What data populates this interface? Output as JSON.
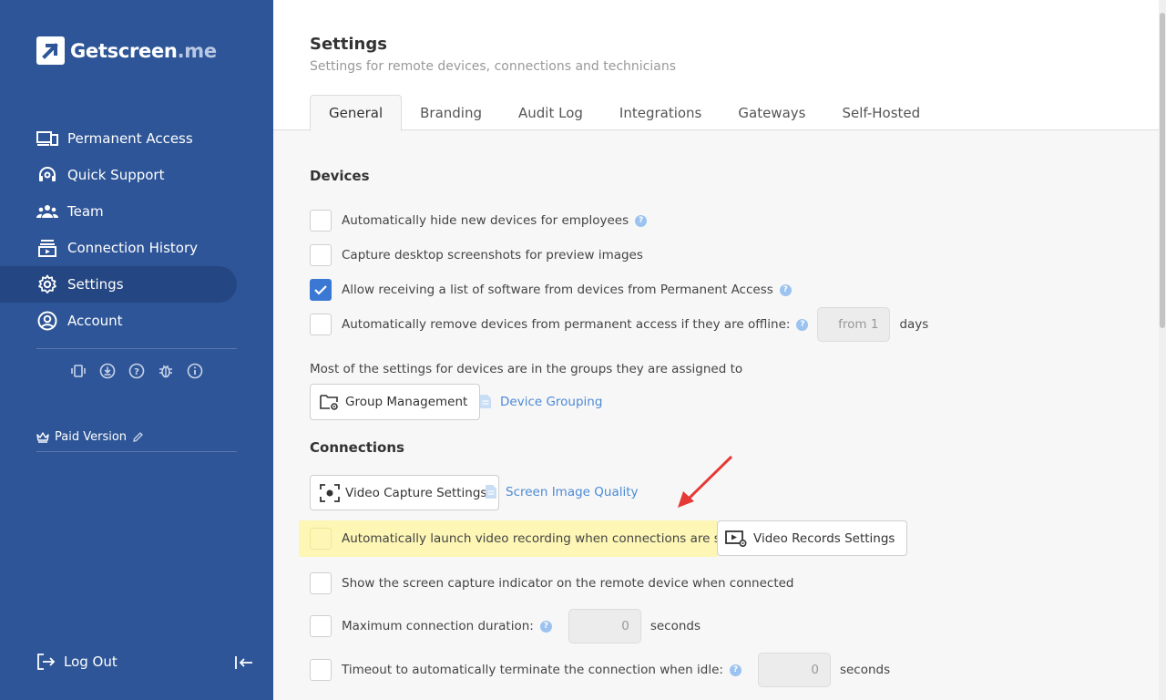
{
  "brand": {
    "name": "Getscreen",
    "suffix": ".me"
  },
  "nav": [
    {
      "label": "Permanent Access",
      "icon": "devices-icon"
    },
    {
      "label": "Quick Support",
      "icon": "headset-icon"
    },
    {
      "label": "Team",
      "icon": "team-icon"
    },
    {
      "label": "Connection History",
      "icon": "history-icon"
    },
    {
      "label": "Settings",
      "icon": "gear-icon",
      "active": true
    },
    {
      "label": "Account",
      "icon": "user-circle-icon"
    }
  ],
  "sidebar_footer": {
    "plan": "Paid Version",
    "logout": "Log Out"
  },
  "header": {
    "title": "Settings",
    "subtitle": "Settings for remote devices, connections and technicians",
    "tabs": [
      "General",
      "Branding",
      "Audit Log",
      "Integrations",
      "Gateways",
      "Self-Hosted"
    ],
    "active_tab": "General"
  },
  "devices": {
    "title": "Devices",
    "options": [
      {
        "label": "Automatically hide new devices for employees",
        "checked": false,
        "help": true
      },
      {
        "label": "Capture desktop screenshots for preview images",
        "checked": false,
        "help": false
      },
      {
        "label": "Allow receiving a list of software from devices from Permanent Access",
        "checked": true,
        "help": true
      },
      {
        "label": "Automatically remove devices from permanent access if they are offline:",
        "checked": false,
        "help": true,
        "input_placeholder": "from 1",
        "unit": "days"
      }
    ],
    "groups_note": "Most of the settings for devices are in the groups they are assigned to",
    "group_button": "Group Management",
    "group_link": "Device Grouping"
  },
  "connections": {
    "title": "Connections",
    "video_button": "Video Capture Settings",
    "quality_link": "Screen Image Quality",
    "options": [
      {
        "label": "Automatically launch video recording when connections are started",
        "checked": false,
        "highlighted": true
      },
      {
        "label": "Show the screen capture indicator on the remote device when connected",
        "checked": false
      },
      {
        "label": "Maximum connection duration:",
        "checked": false,
        "help": true,
        "value": "0",
        "unit": "seconds"
      },
      {
        "label": "Timeout to automatically terminate the connection when idle:",
        "checked": false,
        "help": true,
        "value": "0",
        "unit": "seconds"
      }
    ],
    "records_button": "Video Records Settings"
  },
  "colors": {
    "sidebar": "#2e5597",
    "sidebar_active": "#244682",
    "accent": "#3a78d4",
    "link": "#4d8ad6",
    "highlight": "#fdf6b5",
    "annotation_arrow": "#e53935"
  }
}
